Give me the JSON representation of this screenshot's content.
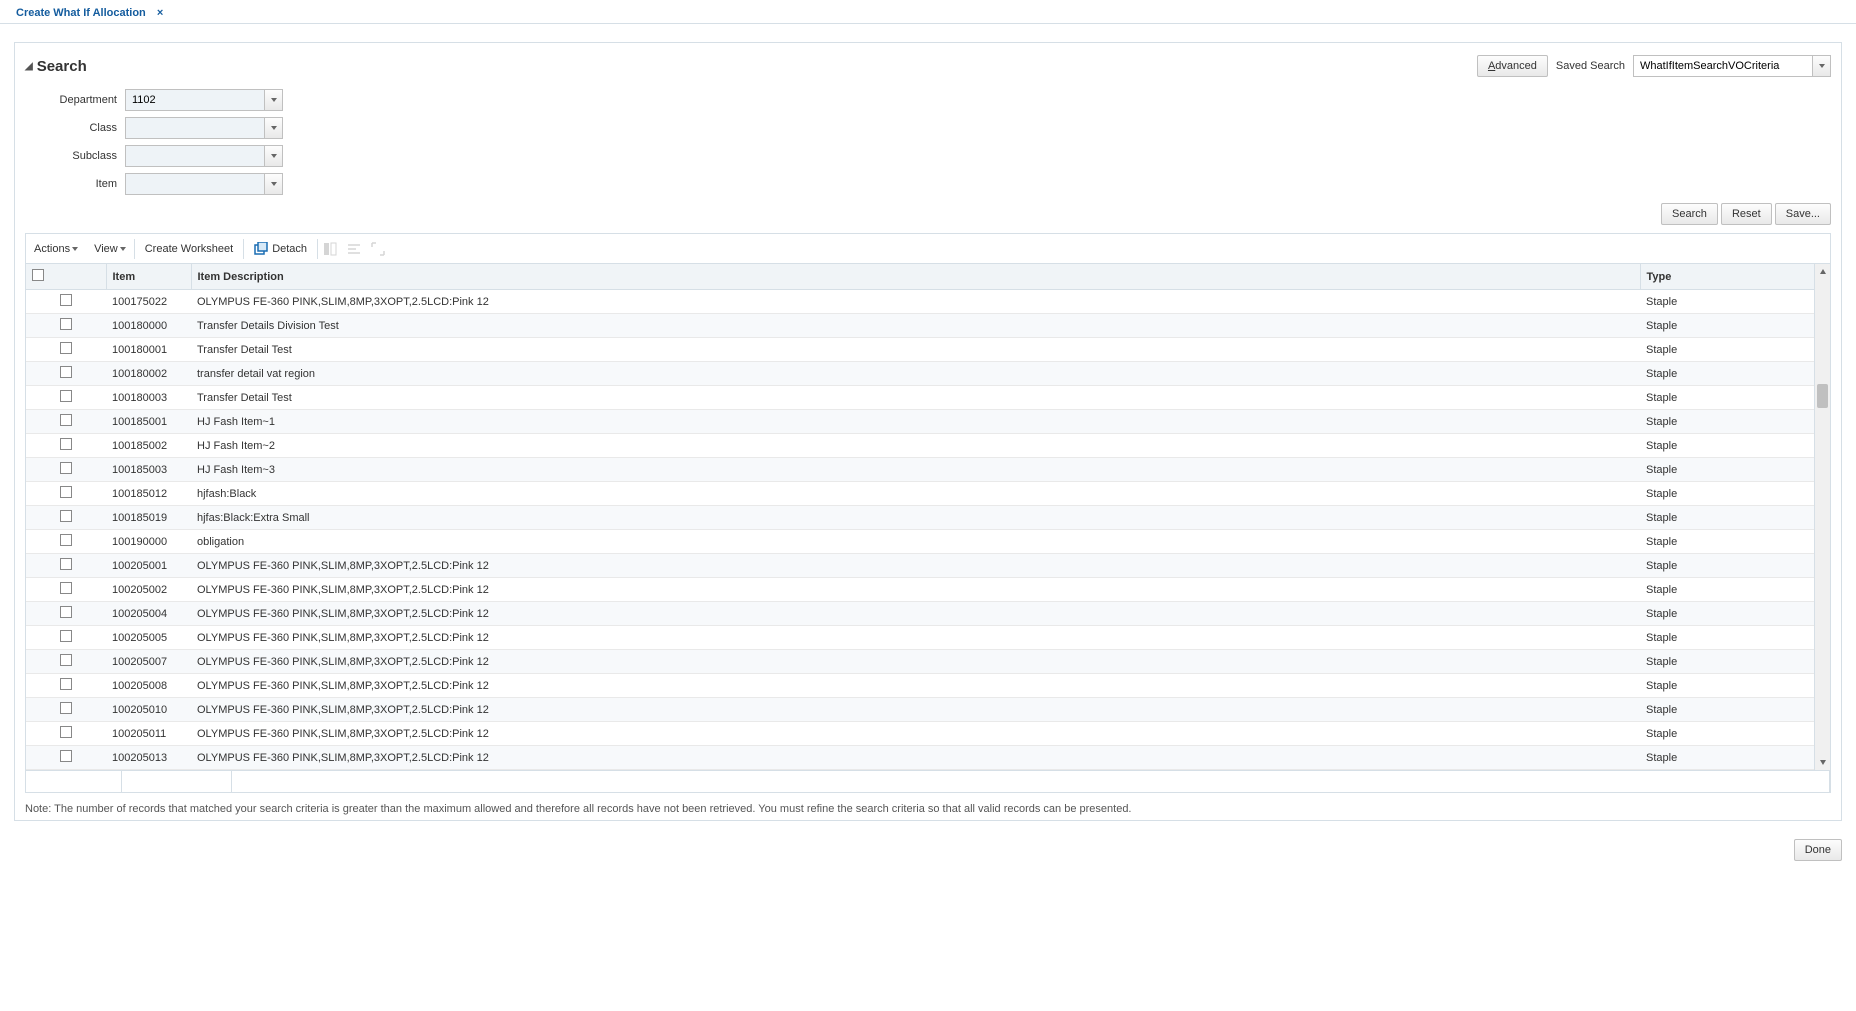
{
  "tab": {
    "title": "Create What If Allocation"
  },
  "search": {
    "title": "Search",
    "advanced_btn": "Advanced",
    "saved_search_label": "Saved Search",
    "saved_search_value": "WhatIfItemSearchVOCriteria",
    "fields": {
      "department": {
        "label": "Department",
        "value": "1102"
      },
      "class_": {
        "label": "Class",
        "value": ""
      },
      "subclass": {
        "label": "Subclass",
        "value": ""
      },
      "item": {
        "label": "Item",
        "value": ""
      }
    },
    "buttons": {
      "search": "Search",
      "reset": "Reset",
      "save": "Save..."
    }
  },
  "toolbar": {
    "actions": "Actions",
    "view": "View",
    "create_worksheet": "Create Worksheet",
    "detach": "Detach"
  },
  "table": {
    "headers": {
      "item": "Item",
      "desc": "Item Description",
      "type": "Type"
    },
    "rows": [
      {
        "item": "100175022",
        "desc": "OLYMPUS FE-360 PINK,SLIM,8MP,3XOPT,2.5LCD:Pink 12",
        "type": "Staple"
      },
      {
        "item": "100180000",
        "desc": "Transfer Details Division Test",
        "type": "Staple"
      },
      {
        "item": "100180001",
        "desc": "Transfer Detail Test",
        "type": "Staple"
      },
      {
        "item": "100180002",
        "desc": "transfer detail vat region",
        "type": "Staple"
      },
      {
        "item": "100180003",
        "desc": "Transfer Detail Test",
        "type": "Staple"
      },
      {
        "item": "100185001",
        "desc": "HJ Fash Item~1",
        "type": "Staple"
      },
      {
        "item": "100185002",
        "desc": "HJ Fash Item~2",
        "type": "Staple"
      },
      {
        "item": "100185003",
        "desc": "HJ Fash Item~3",
        "type": "Staple"
      },
      {
        "item": "100185012",
        "desc": "hjfash:Black",
        "type": "Staple"
      },
      {
        "item": "100185019",
        "desc": "hjfas:Black:Extra Small",
        "type": "Staple"
      },
      {
        "item": "100190000",
        "desc": "obligation",
        "type": "Staple"
      },
      {
        "item": "100205001",
        "desc": "OLYMPUS FE-360 PINK,SLIM,8MP,3XOPT,2.5LCD:Pink 12",
        "type": "Staple"
      },
      {
        "item": "100205002",
        "desc": "OLYMPUS FE-360 PINK,SLIM,8MP,3XOPT,2.5LCD:Pink 12",
        "type": "Staple"
      },
      {
        "item": "100205004",
        "desc": "OLYMPUS FE-360 PINK,SLIM,8MP,3XOPT,2.5LCD:Pink 12",
        "type": "Staple"
      },
      {
        "item": "100205005",
        "desc": "OLYMPUS FE-360 PINK,SLIM,8MP,3XOPT,2.5LCD:Pink 12",
        "type": "Staple"
      },
      {
        "item": "100205007",
        "desc": "OLYMPUS FE-360 PINK,SLIM,8MP,3XOPT,2.5LCD:Pink 12",
        "type": "Staple"
      },
      {
        "item": "100205008",
        "desc": "OLYMPUS FE-360 PINK,SLIM,8MP,3XOPT,2.5LCD:Pink 12",
        "type": "Staple"
      },
      {
        "item": "100205010",
        "desc": "OLYMPUS FE-360 PINK,SLIM,8MP,3XOPT,2.5LCD:Pink 12",
        "type": "Staple"
      },
      {
        "item": "100205011",
        "desc": "OLYMPUS FE-360 PINK,SLIM,8MP,3XOPT,2.5LCD:Pink 12",
        "type": "Staple"
      },
      {
        "item": "100205013",
        "desc": "OLYMPUS FE-360 PINK,SLIM,8MP,3XOPT,2.5LCD:Pink 12",
        "type": "Staple"
      }
    ]
  },
  "note": "Note: The number of records that matched your search criteria is greater than the maximum allowed and therefore all records have not been retrieved. You must refine the search criteria so that all valid records can be presented.",
  "done": "Done"
}
